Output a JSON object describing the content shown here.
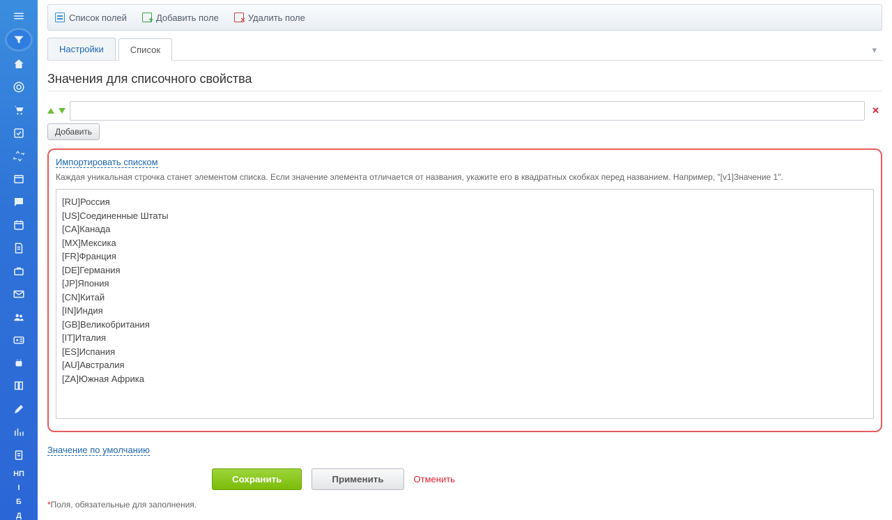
{
  "sidebar": {
    "text_items": [
      "НП",
      "I",
      "Б",
      "Д"
    ]
  },
  "toolbar": {
    "field_list": "Список полей",
    "add_field": "Добавить поле",
    "delete_field": "Удалить поле"
  },
  "tabs": {
    "settings": "Настройки",
    "list": "Список"
  },
  "heading": "Значения для списочного свойства",
  "add_button": "Добавить",
  "import": {
    "link": "Импортировать списком",
    "hint": "Каждая уникальная строчка станет элементом списка. Если значение элемента отличается от названия, укажите его в квадратных скобках перед названием. Например, \"[v1]Значение 1\".",
    "textarea_value": "[RU]Россия\n[US]Соединенные Штаты\n[CA]Канада\n[MX]Мексика\n[FR]Франция\n[DE]Германия\n[JP]Япония\n[CN]Китай\n[IN]Индия\n[GB]Великобритания\n[IT]Италия\n[ES]Испания\n[AU]Австралия\n[ZA]Южная Африка"
  },
  "default_value_link": "Значение по умолчанию",
  "footer": {
    "save": "Сохранить",
    "apply": "Применить",
    "cancel": "Отменить"
  },
  "required_note": "Поля, обязательные для заполнения."
}
